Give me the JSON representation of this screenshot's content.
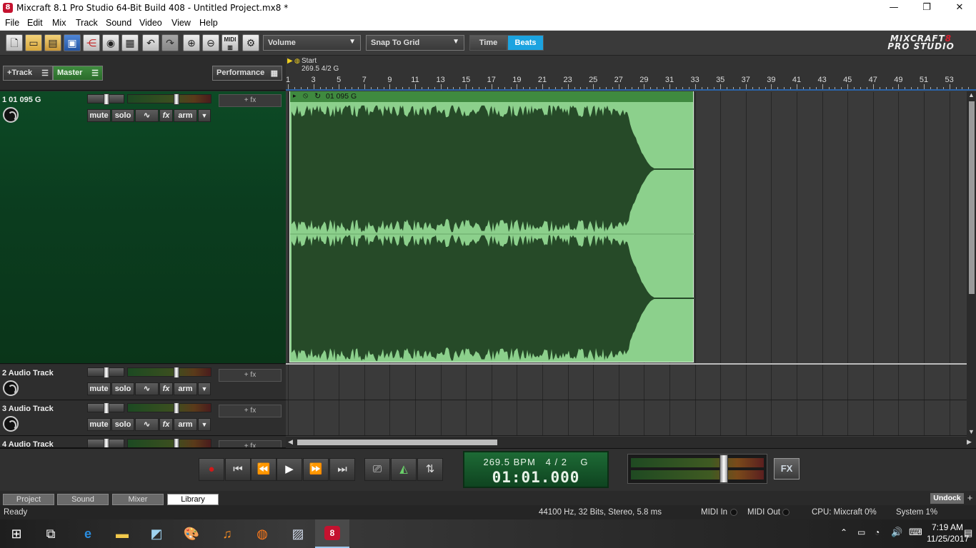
{
  "window": {
    "title": "Mixcraft 8.1 Pro Studio 64-Bit Build 408 - Untitled Project.mx8 *",
    "app_icon": "8",
    "minimize": "—",
    "maximize": "❐",
    "close": "✕"
  },
  "menu": [
    "File",
    "Edit",
    "Mix",
    "Track",
    "Sound",
    "Video",
    "View",
    "Help"
  ],
  "toolbar": {
    "volume_combo": "Volume",
    "snap_combo": "Snap To Grid",
    "time_label": "Time",
    "beats_label": "Beats",
    "icons": [
      "new-icon",
      "open-icon",
      "open-folder-icon",
      "save-icon",
      "share-icon",
      "burn-cd-icon",
      "video-icon",
      "undo-icon",
      "redo-icon",
      "zoom-in-icon",
      "zoom-out-icon",
      "midi-icon",
      "settings-icon"
    ],
    "midi_label": "MIDI"
  },
  "logo": {
    "line1": "MIXCRAFT",
    "num": "8",
    "line2": "PRO STUDIO"
  },
  "left_header": {
    "add_track": "+Track",
    "master": "Master",
    "performance": "Performance"
  },
  "tracks": [
    {
      "name": "1 01 095 G",
      "fx": "+ fx",
      "mute": "mute",
      "solo": "solo",
      "fx_btn": "fx",
      "arm": "arm"
    },
    {
      "name": "2 Audio Track",
      "fx": "+ fx",
      "mute": "mute",
      "solo": "solo",
      "fx_btn": "fx",
      "arm": "arm"
    },
    {
      "name": "3 Audio Track",
      "fx": "+ fx",
      "mute": "mute",
      "solo": "solo",
      "fx_btn": "fx",
      "arm": "arm"
    },
    {
      "name": "4 Audio Track",
      "fx": "+ fx"
    }
  ],
  "ruler": {
    "start_label": "Start",
    "tempo_label": "269.5 4/2 G",
    "numbers": [
      "1",
      "3",
      "5",
      "7",
      "9",
      "11",
      "13",
      "15",
      "17",
      "19",
      "21",
      "23",
      "25",
      "27",
      "29",
      "31",
      "33",
      "35",
      "37",
      "39",
      "41",
      "43",
      "45",
      "47",
      "49",
      "51",
      "53",
      "5"
    ]
  },
  "clip": {
    "name": "01 095 G"
  },
  "lcd": {
    "tempo": "269.5 BPM",
    "signature": "4 / 2",
    "key": "G",
    "position": "01:01.000"
  },
  "fx_button": "FX",
  "tabs": [
    "Project",
    "Sound",
    "Mixer",
    "Library"
  ],
  "active_tab": "Library",
  "undock": "Undock",
  "status": {
    "ready": "Ready",
    "format": "44100 Hz, 32 Bits, Stereo, 5.8 ms",
    "midi_in": "MIDI In",
    "midi_out": "MIDI Out",
    "cpu": "CPU: Mixcraft 0%",
    "system": "System 1%"
  },
  "taskbar": {
    "time": "7:19 AM",
    "date": "11/25/2017"
  }
}
